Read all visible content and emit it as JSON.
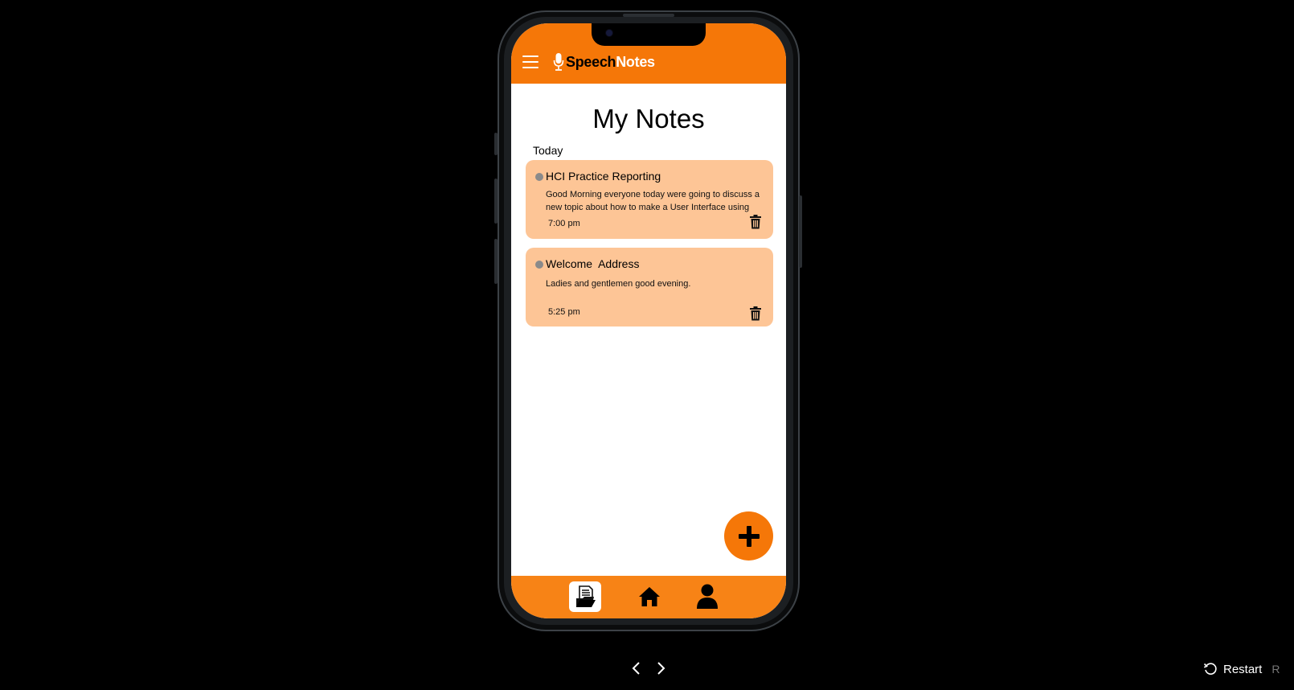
{
  "app": {
    "logo_part1": "Speech",
    "logo_part2": "Notes",
    "brand_color": "#f57708",
    "card_color": "#fdc596"
  },
  "page": {
    "title": "My Notes",
    "section_label": "Today"
  },
  "notes": [
    {
      "title": "HCI Practice Reporting",
      "body": "Good Morning everyone today were going to discuss a new topic about how to make a User Interface using",
      "time": "7:00 pm"
    },
    {
      "title": "Welcome  Address",
      "body": "Ladies and gentlemen good evening.",
      "time": "5:25 pm"
    }
  ],
  "icons": {
    "menu": "hamburger-icon",
    "logo": "microphone-icon",
    "delete": "trash-icon",
    "add": "plus-icon",
    "nav_notes": "notes-folder-icon",
    "nav_home": "home-icon",
    "nav_profile": "user-icon",
    "prev": "chevron-left-icon",
    "next": "chevron-right-icon",
    "restart": "restart-icon"
  },
  "prototype": {
    "restart_label": "Restart",
    "restart_key": "R"
  }
}
